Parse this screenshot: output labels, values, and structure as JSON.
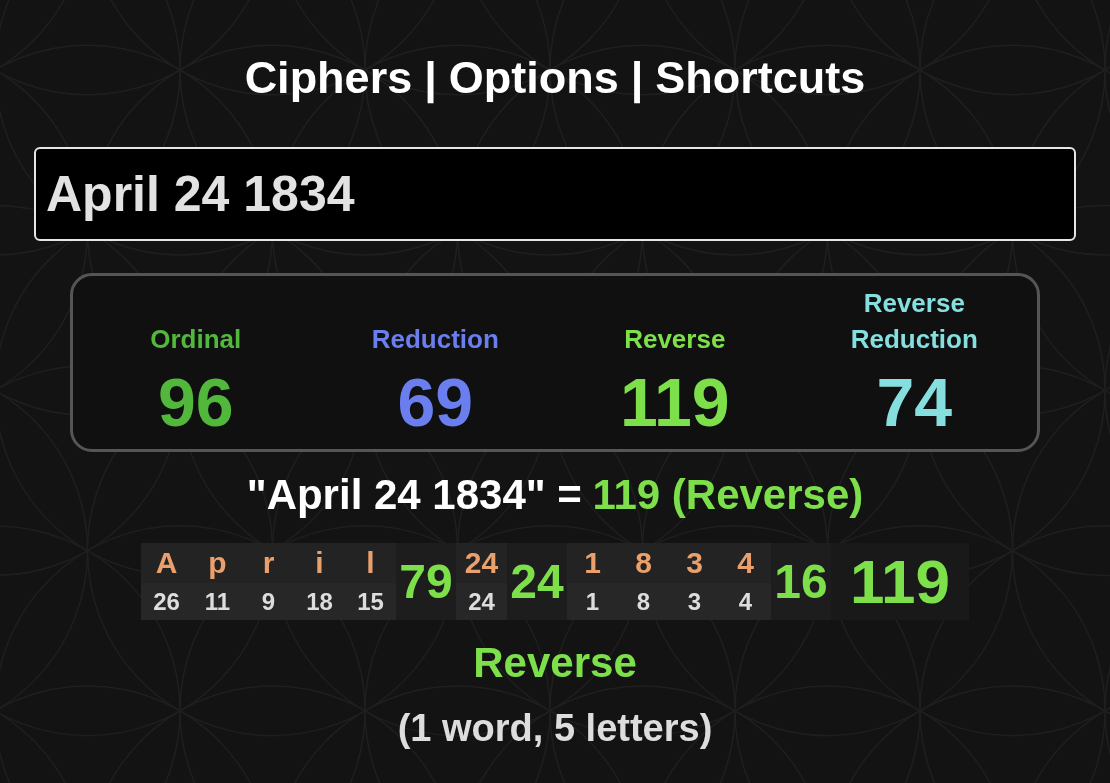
{
  "nav": {
    "links": [
      "Ciphers",
      "Options",
      "Shortcuts"
    ],
    "separators": [
      "|",
      "|"
    ]
  },
  "input": {
    "value": "April 24 1834"
  },
  "ciphers": [
    {
      "name": "Ordinal",
      "value": "96",
      "color": "#52b83c"
    },
    {
      "name": "Reduction",
      "value": "69",
      "color": "#6a7ef0"
    },
    {
      "name": "Reverse",
      "value": "119",
      "color": "#7de04b"
    },
    {
      "name": "Reverse Reduction",
      "value": "74",
      "color": "#86dfdf"
    }
  ],
  "summary": {
    "phrase": "\"April 24 1834\" =",
    "result": "119 (Reverse)"
  },
  "breakdown": {
    "groups": [
      {
        "chars": [
          {
            "char": "A",
            "value": "26"
          },
          {
            "char": "p",
            "value": "11"
          },
          {
            "char": "r",
            "value": "9"
          },
          {
            "char": "i",
            "value": "18"
          },
          {
            "char": "l",
            "value": "15"
          }
        ],
        "total": "79"
      },
      {
        "chars": [
          {
            "char": "24",
            "value": "24"
          }
        ],
        "total": "24"
      },
      {
        "chars": [
          {
            "char": "1",
            "value": "1"
          },
          {
            "char": "8",
            "value": "8"
          },
          {
            "char": "3",
            "value": "3"
          },
          {
            "char": "4",
            "value": "4"
          }
        ],
        "total": "16"
      }
    ],
    "total": "119"
  },
  "footer": {
    "cipher": "Reverse",
    "counts": "(1 word, 5 letters)"
  }
}
